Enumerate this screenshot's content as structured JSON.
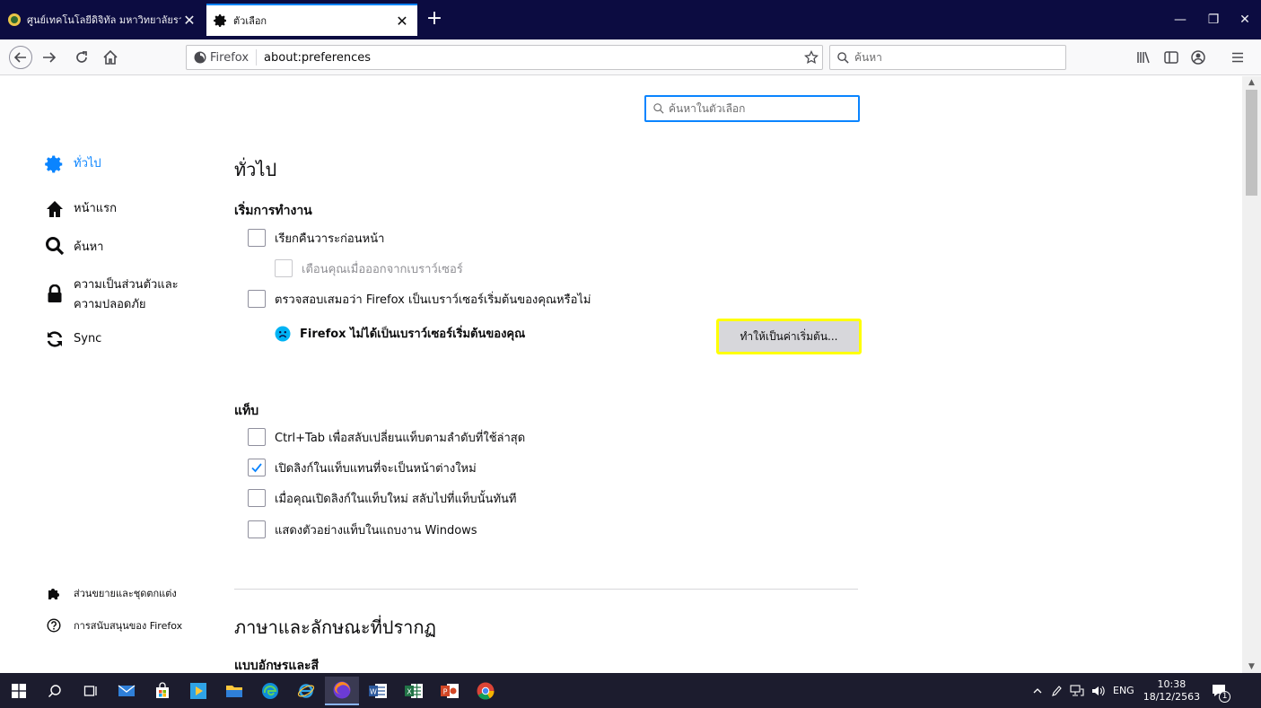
{
  "tabs": [
    {
      "label": "ศูนย์เทคโนโลยีดิจิทัล มหาวิทยาลัยราช",
      "close": "✕",
      "active": false
    },
    {
      "label": "ตัวเลือก",
      "close": "✕",
      "active": true
    }
  ],
  "newtab_label": "+",
  "window_controls": {
    "minimize": "—",
    "restore": "❐",
    "close": "✕"
  },
  "urlbar": {
    "identity_label": "Firefox",
    "url": "about:preferences"
  },
  "searchbar": {
    "placeholder": "ค้นหา"
  },
  "pref_search": {
    "placeholder": "ค้นหาในตัวเลือก"
  },
  "categories": [
    {
      "label": "ทั่วไป",
      "icon": "gear-icon",
      "selected": true
    },
    {
      "label": "หน้าแรก",
      "icon": "home-icon",
      "selected": false
    },
    {
      "label": "ค้นหา",
      "icon": "search-icon",
      "selected": false
    },
    {
      "label_line1": "ความเป็นส่วนตัวและ",
      "label_line2": "ความปลอดภัย",
      "icon": "lock-icon",
      "selected": false
    },
    {
      "label": "Sync",
      "icon": "sync-icon",
      "selected": false
    }
  ],
  "footer_links": [
    {
      "label": "ส่วนขยายและชุดตกแต่ง",
      "icon": "puzzle-icon"
    },
    {
      "label": "การสนับสนุนของ Firefox",
      "icon": "help-icon"
    }
  ],
  "main": {
    "title": "ทั่วไป",
    "startup": {
      "heading": "เริ่มการทำงาน",
      "restore_session": {
        "label": "เรียกคืนวาระก่อนหน้า",
        "checked": false
      },
      "warn_on_quit": {
        "label": "เตือนคุณเมื่อออกจากเบราว์เซอร์",
        "checked": false,
        "disabled": true
      },
      "check_default": {
        "label": "ตรวจสอบเสมอว่า Firefox เป็นเบราว์เซอร์เริ่มต้นของคุณหรือไม่",
        "checked": false
      },
      "default_status": "Firefox ไม่ได้เป็นเบราว์เซอร์เริ่มต้นของคุณ",
      "make_default_button": "ทำให้เป็นค่าเริ่มต้น..."
    },
    "tabs_section": {
      "heading": "แท็บ",
      "ctrl_tab": {
        "label": "Ctrl+Tab เพื่อสลับเปลี่ยนแท็บตามลำดับที่ใช้ล่าสุด",
        "checked": false
      },
      "open_links_in_tabs": {
        "label": "เปิดลิงก์ในแท็บแทนที่จะเป็นหน้าต่างใหม่",
        "checked": true
      },
      "switch_to_new_tab": {
        "label": "เมื่อคุณเปิดลิงก์ในแท็บใหม่ สลับไปที่แท็บนั้นทันที",
        "checked": false
      },
      "taskbar_previews": {
        "label": "แสดงตัวอย่างแท็บในแถบงาน Windows",
        "checked": false
      }
    },
    "language_section": {
      "title": "ภาษาและลักษณะที่ปรากฏ",
      "fonts_heading": "แบบอักษรและสี"
    }
  },
  "taskbar": {
    "lang": "ENG",
    "time": "10:38",
    "date": "18/12/2563",
    "notification_count": "1"
  },
  "colors": {
    "accent": "#0a84ff",
    "tab_strip": "#0c0c41",
    "highlight_border": "#ffff00",
    "warning_face": "#00b3f4"
  }
}
